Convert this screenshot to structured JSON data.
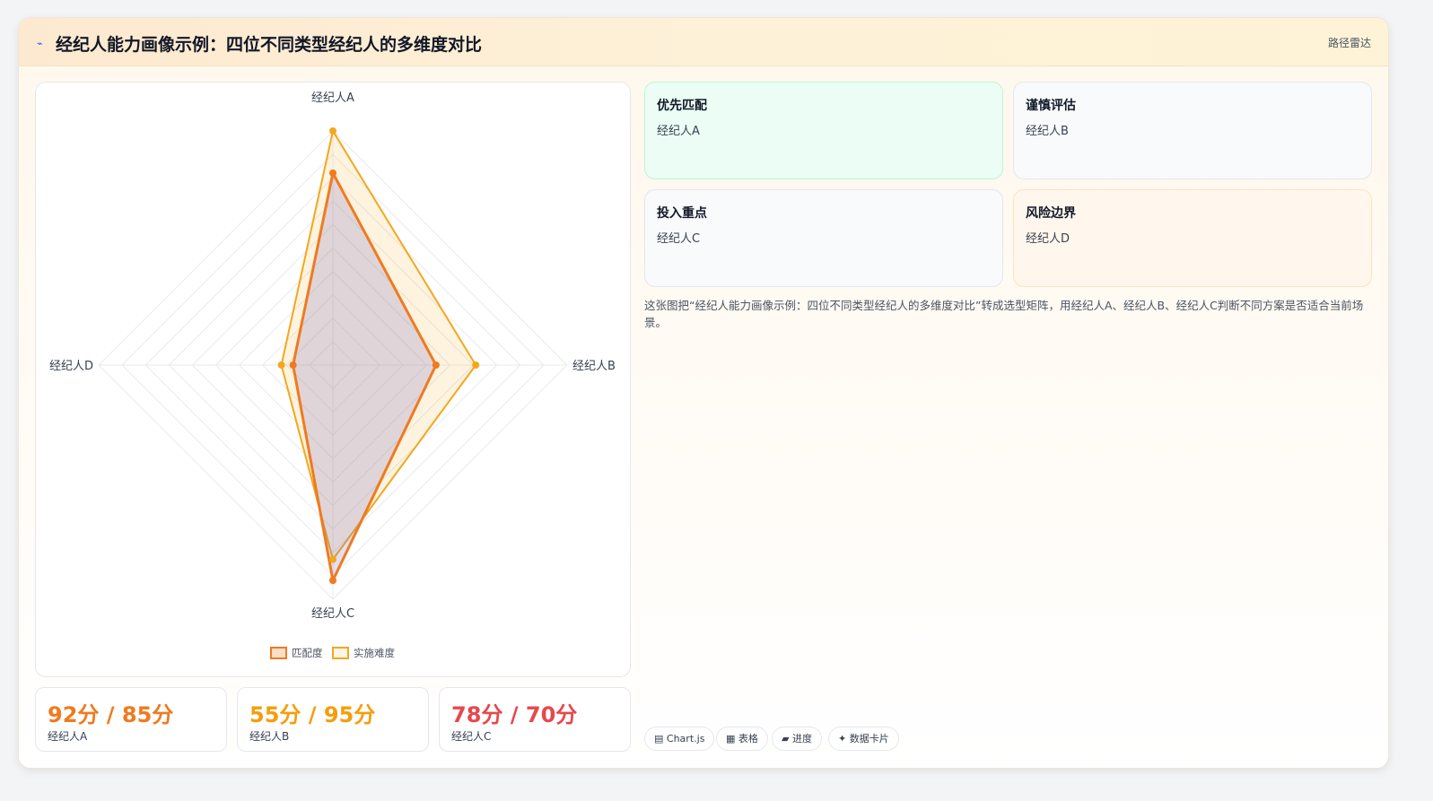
{
  "header": {
    "title": "经纪人能力画像示例：四位不同类型经纪人的多维度对比",
    "tag": "路径雷达",
    "icon": "sparkle-icon"
  },
  "chart_data": {
    "type": "radar",
    "categories": [
      "经纪人A",
      "经纪人B",
      "经纪人C",
      "经纪人D"
    ],
    "series": [
      {
        "name": "匹配度",
        "values": [
          82,
          44,
          92,
          17
        ],
        "color": "#f07a1f"
      },
      {
        "name": "实施难度",
        "values": [
          100,
          61,
          83,
          22
        ],
        "color": "#f2a81d"
      }
    ],
    "rlim": [
      0,
      100
    ],
    "legend_position": "bottom",
    "grid": true
  },
  "stats": [
    {
      "value": "92分 / 85分",
      "label": "经纪人A",
      "color": "#f07a1f"
    },
    {
      "value": "55分 / 95分",
      "label": "经纪人B",
      "color": "#f59e0b"
    },
    {
      "value": "78分 / 70分",
      "label": "经纪人C",
      "color": "#e5484d"
    }
  ],
  "quadrants": [
    {
      "title": "优先匹配",
      "value": "经纪人A",
      "bg": "#ecfdf5",
      "border": "#bbf7d0"
    },
    {
      "title": "谨慎评估",
      "value": "经纪人B",
      "bg": "#f8fafc",
      "border": "#e5e7eb"
    },
    {
      "title": "投入重点",
      "value": "经纪人C",
      "bg": "#f8fafc",
      "border": "#e5e7eb"
    },
    {
      "title": "风险边界",
      "value": "经纪人D",
      "bg": "#fff7ed",
      "border": "#fde2c4"
    }
  ],
  "description": "这张图把“经纪人能力画像示例：四位不同类型经纪人的多维度对比”转成选型矩阵，用经纪人A、经纪人B、经纪人C判断不同方案是否适合当前场景。",
  "chips": [
    {
      "icon": "chart-icon",
      "glyph": "▤",
      "label": "Chart.js"
    },
    {
      "icon": "table-icon",
      "glyph": "▦",
      "label": "表格"
    },
    {
      "icon": "progress-icon",
      "glyph": "▰",
      "label": "进度"
    },
    {
      "icon": "card-icon",
      "glyph": "✦",
      "label": "数据卡片"
    }
  ]
}
